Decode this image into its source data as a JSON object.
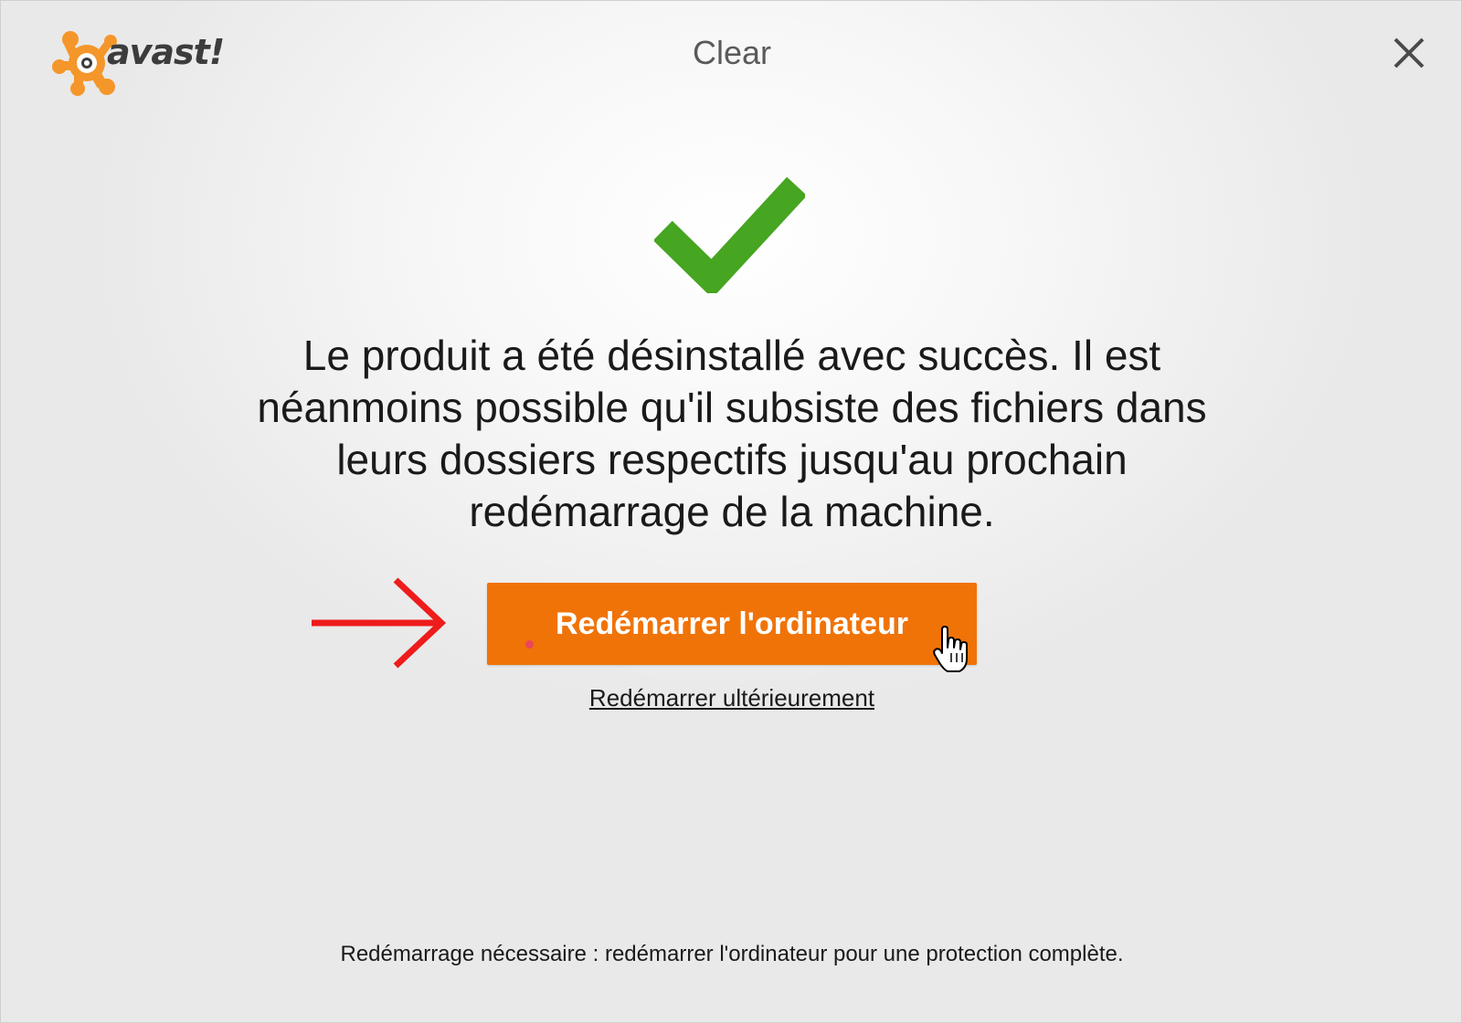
{
  "app": {
    "logo_text": "avast!",
    "title": "Clear"
  },
  "icons": {
    "logo": "avast-logo-icon",
    "close": "close-icon",
    "success": "checkmark-icon",
    "annotation": "red-arrow-icon",
    "cursor": "hand-pointer-icon"
  },
  "main": {
    "message_lines": [
      "Le produit a été désinstallé avec succès. Il est",
      "néanmoins possible qu'il subsiste des fichiers dans",
      "leurs dossiers respectifs jusqu'au prochain",
      "redémarrage de la machine."
    ],
    "restart_button_label": "Redémarrer l'ordinateur",
    "restart_later_label": "Redémarrer ultérieurement"
  },
  "footer": {
    "note": "Redémarrage nécessaire : redémarrer l'ordinateur pour une protection complète."
  },
  "colors": {
    "accent": "#f07308",
    "success": "#46a521",
    "annotation": "#ee1c1c",
    "logo_orange": "#f4962a"
  }
}
